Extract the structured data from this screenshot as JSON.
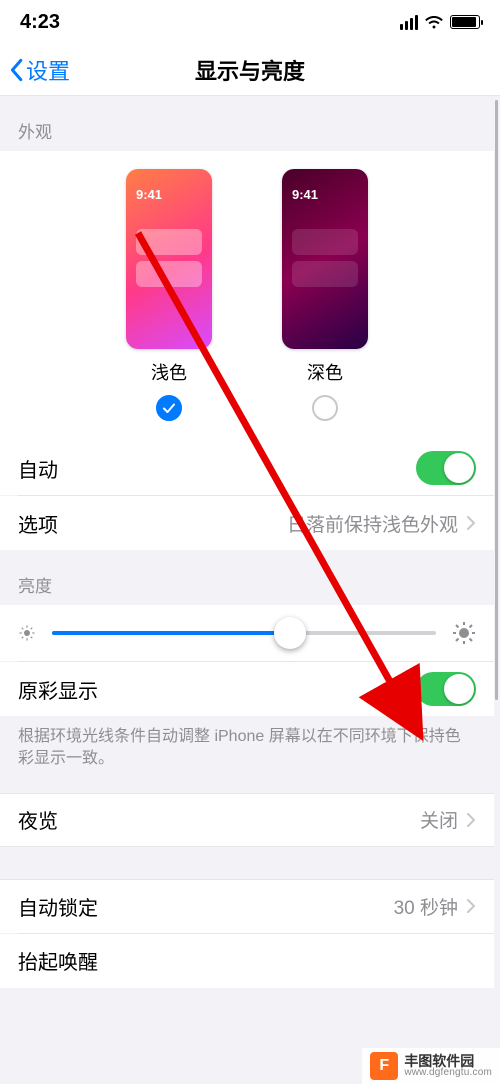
{
  "status": {
    "time": "4:23"
  },
  "nav": {
    "back_label": "设置",
    "title": "显示与亮度"
  },
  "sections": {
    "appearance_header": "外观",
    "brightness_header": "亮度"
  },
  "appearance": {
    "preview_time": "9:41",
    "light_label": "浅色",
    "dark_label": "深色",
    "selected": "light"
  },
  "rows": {
    "auto_label": "自动",
    "auto_on": true,
    "options_label": "选项",
    "options_value": "日落前保持浅色外观",
    "truetone_label": "原彩显示",
    "truetone_on": true,
    "truetone_footer": "根据环境光线条件自动调整 iPhone 屏幕以在不同环境下保持色彩显示一致。",
    "nightshift_label": "夜览",
    "nightshift_value": "关闭",
    "autolock_label": "自动锁定",
    "autolock_value": "30 秒钟",
    "raise_label": "抬起唤醒"
  },
  "watermark": {
    "name": "丰图软件园",
    "url": "www.dgfengtu.com",
    "icon_letter": "F"
  }
}
